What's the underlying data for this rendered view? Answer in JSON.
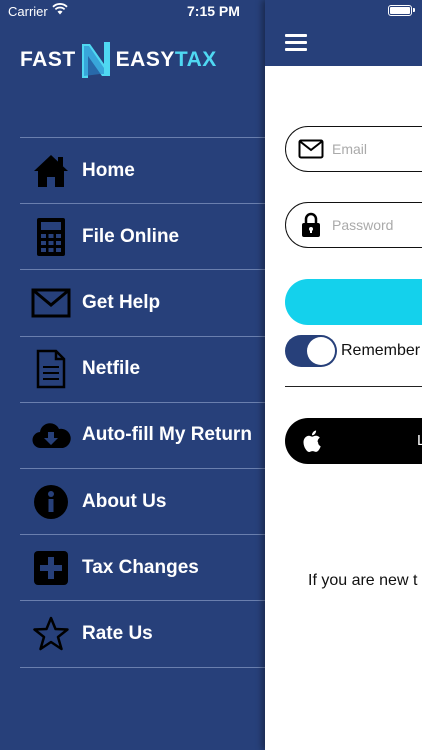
{
  "status_bar": {
    "carrier": "Carrier",
    "time": "7:15 PM"
  },
  "logo": {
    "part1": "FAST",
    "part2": "EASY",
    "part3": "TAX"
  },
  "menu": [
    {
      "label": "Home",
      "icon": "home-icon"
    },
    {
      "label": "File Online",
      "icon": "calculator-icon"
    },
    {
      "label": "Get Help",
      "icon": "envelope-icon"
    },
    {
      "label": "Netfile",
      "icon": "document-icon"
    },
    {
      "label": "Auto-fill My Return",
      "icon": "cloud-download-icon"
    },
    {
      "label": "About Us",
      "icon": "info-icon"
    },
    {
      "label": "Tax Changes",
      "icon": "plus-icon"
    },
    {
      "label": "Rate Us",
      "icon": "star-icon"
    }
  ],
  "login": {
    "email_placeholder": "Email",
    "password_placeholder": "Password",
    "remember_label": "Remember",
    "apple_label": "L",
    "new_user_text": "If you are new t"
  },
  "colors": {
    "navy": "#27407a",
    "cyan": "#14d1ec",
    "logo_tax": "#4fd8f2"
  }
}
